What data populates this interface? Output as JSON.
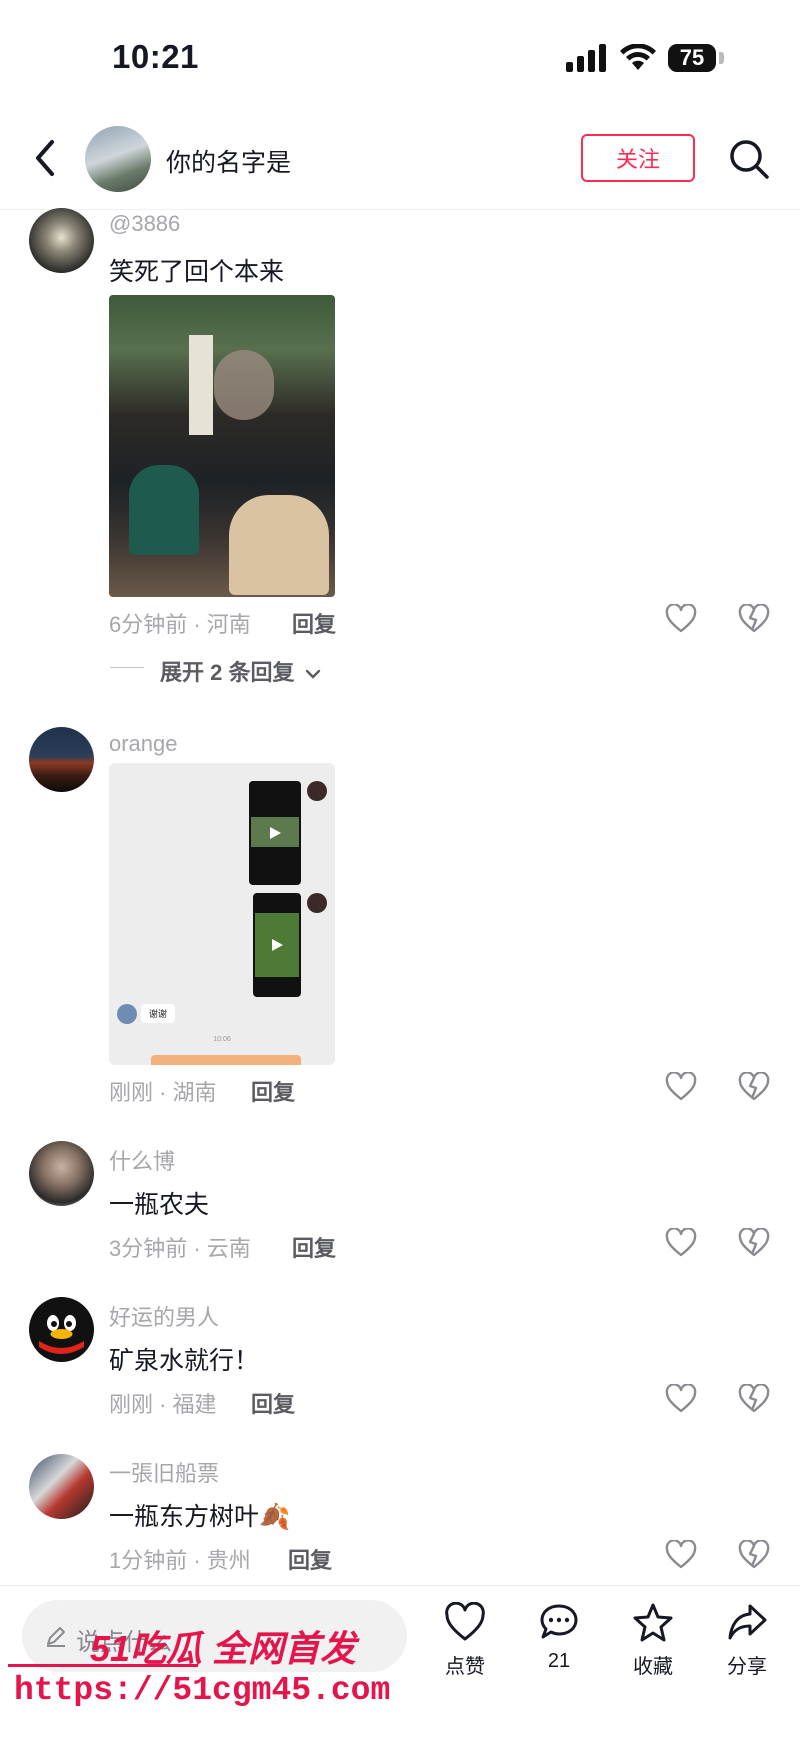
{
  "status_bar": {
    "time": "10:21",
    "battery": "75"
  },
  "header": {
    "title": "你的名字是",
    "follow_label": "关注"
  },
  "comments": [
    {
      "username": "@3886",
      "text": "笑死了回个本来",
      "meta": "6分钟前 · 河南",
      "reply": "回复",
      "expand": "展开 2 条回复"
    },
    {
      "username": "orange",
      "meta": "刚刚 · 湖南",
      "reply": "回复",
      "chat_text": "谢谢",
      "chat_time": "10:06"
    },
    {
      "username": "什么博",
      "text": "一瓶农夫",
      "meta": "3分钟前 · 云南",
      "reply": "回复"
    },
    {
      "username": "好运的男人",
      "text": "矿泉水就行！",
      "meta": "刚刚 · 福建",
      "reply": "回复"
    },
    {
      "username": "一張旧船票",
      "text": "一瓶东方树叶🍂",
      "meta": "1分钟前 · 贵州",
      "reply": "回复"
    }
  ],
  "bottom_bar": {
    "input_placeholder": "说点什么",
    "like_label": "点赞",
    "comment_count": "21",
    "favorite_label": "收藏",
    "share_label": "分享"
  },
  "watermark": {
    "brand": "51吃瓜 全网首发",
    "url": "https://51cgm45.com"
  },
  "colors": {
    "accent": "#fe2c55",
    "watermark": "#e3154b",
    "secondary_text": "#a6a7ab"
  }
}
